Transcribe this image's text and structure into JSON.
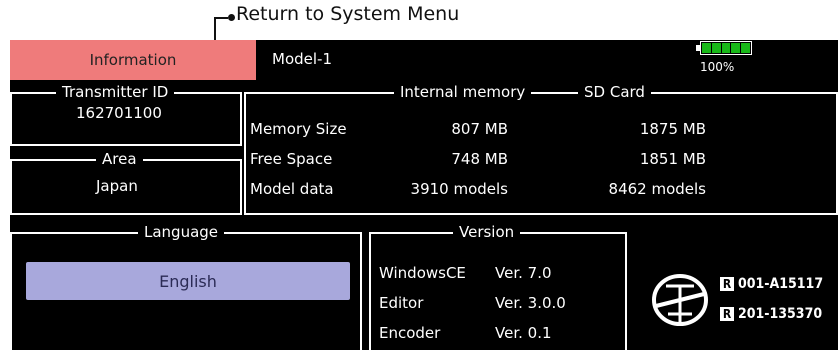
{
  "callout": {
    "label": "Return to System Menu"
  },
  "header": {
    "tab_label": "Information",
    "model_name": "Model-1",
    "battery": {
      "level": 1.0,
      "percent_label": "100%",
      "color": "#18b818"
    }
  },
  "transmitter": {
    "title": "Transmitter ID",
    "value": "162701100"
  },
  "area": {
    "title": "Area",
    "value": "Japan"
  },
  "memory": {
    "col_internal": "Internal memory",
    "col_sd": "SD Card",
    "rows": [
      {
        "label": "Memory Size",
        "internal": "807 MB",
        "sd": "1875 MB"
      },
      {
        "label": "Free Space",
        "internal": "748 MB",
        "sd": "1851 MB"
      },
      {
        "label": "Model data",
        "internal": "3910 models",
        "sd": "8462 models"
      }
    ]
  },
  "language": {
    "title": "Language",
    "selected": "English"
  },
  "version": {
    "title": "Version",
    "rows": [
      {
        "name": "WindowsCE",
        "value": "Ver. 7.0"
      },
      {
        "name": "Editor",
        "value": "Ver. 3.0.0"
      },
      {
        "name": "Encoder",
        "value": "Ver. 0.1"
      }
    ]
  },
  "certification": {
    "mark_letter": "R",
    "codes": [
      "001-A15117",
      "201-135370"
    ],
    "icon": "giteki-mark-icon"
  },
  "colors": {
    "tab_bg": "#ef7b7b",
    "language_button_bg": "#a8a8dc",
    "screen_bg": "#000000"
  }
}
